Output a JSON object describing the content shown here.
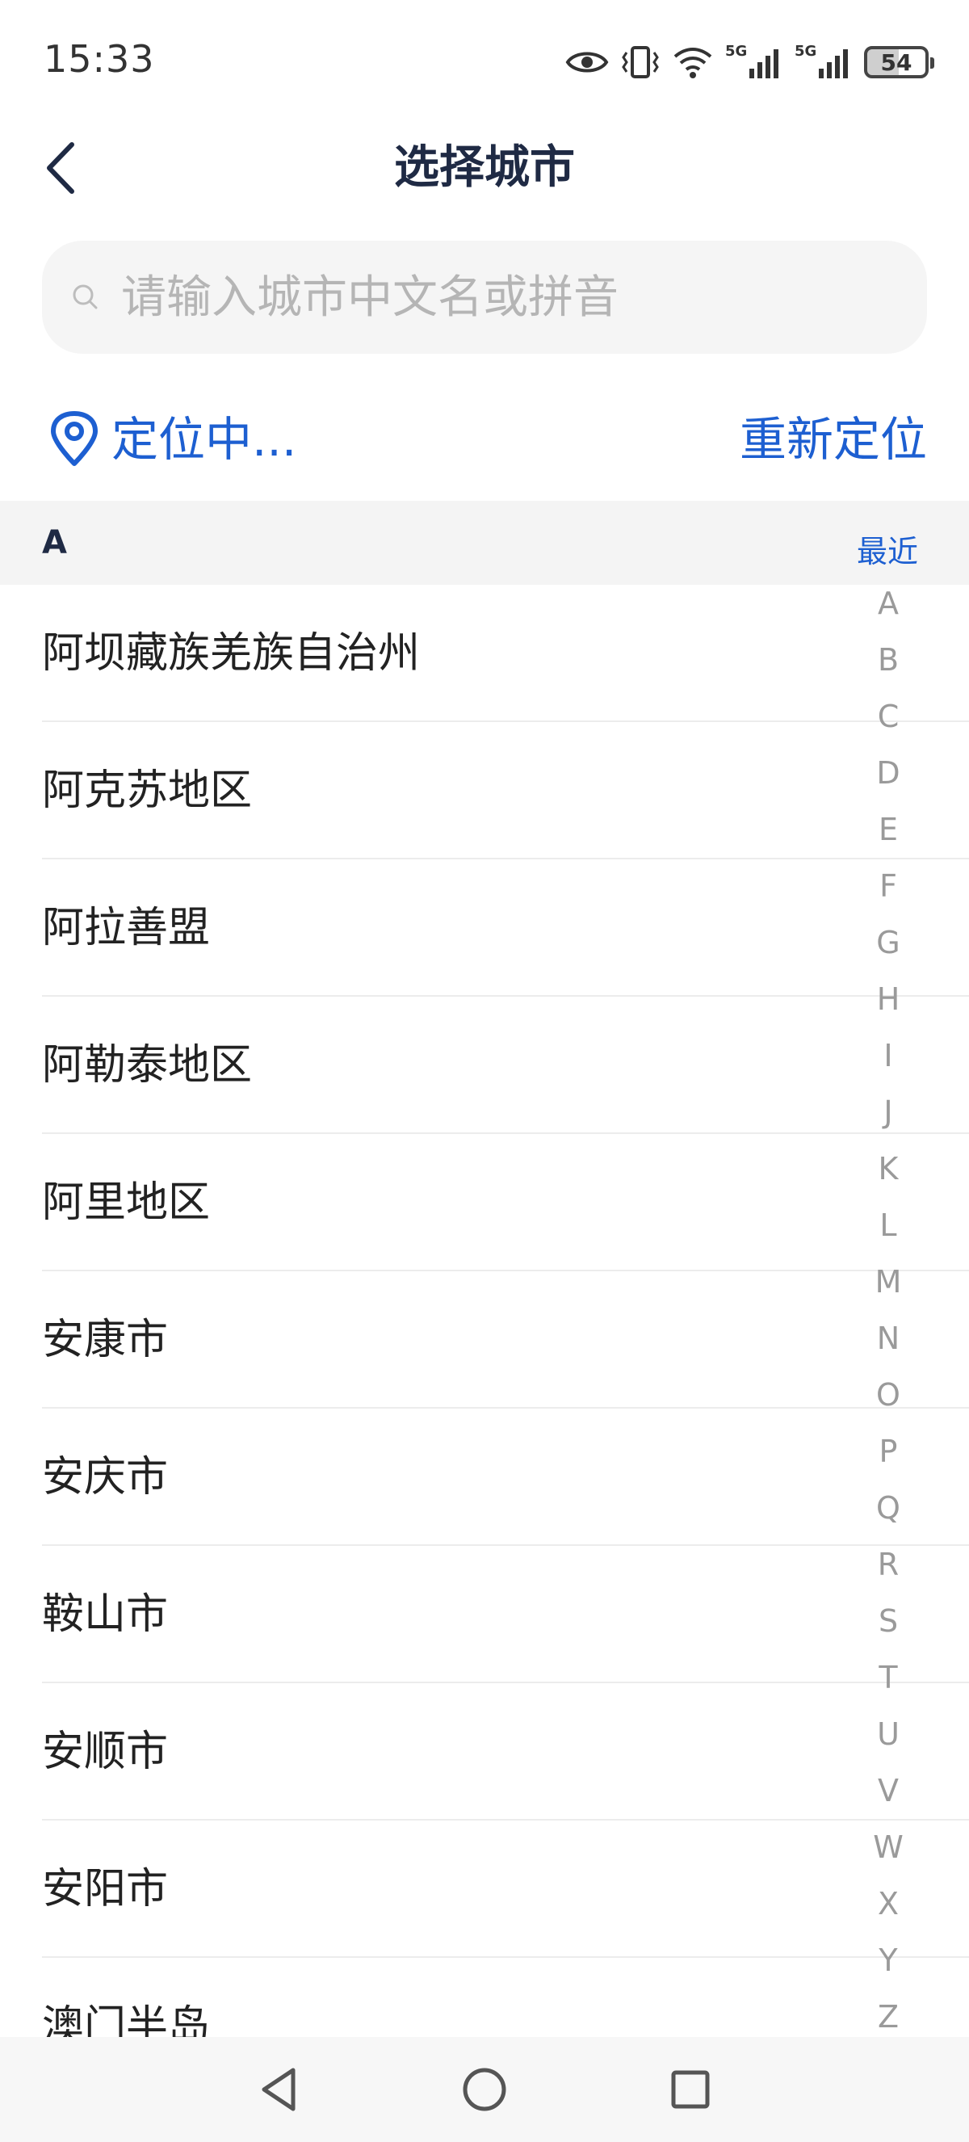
{
  "status_bar": {
    "time": "15:33",
    "battery": "54",
    "icons": [
      "eye-icon",
      "vibrate-icon",
      "wifi-icon",
      "signal-5g-icon",
      "signal-5g-icon"
    ],
    "network_label_1": "5G",
    "network_label_2": "5G"
  },
  "header": {
    "title": "选择城市",
    "back_icon": "chevron-left-icon"
  },
  "search": {
    "placeholder": "请输入城市中文名或拼音",
    "value": ""
  },
  "location": {
    "status": "定位中...",
    "relocate_label": "重新定位",
    "icon": "location-pin-icon"
  },
  "section": {
    "letter": "A",
    "recent_label": "最近"
  },
  "cities": [
    "阿坝藏族羌族自治州",
    "阿克苏地区",
    "阿拉善盟",
    "阿勒泰地区",
    "阿里地区",
    "安康市",
    "安庆市",
    "鞍山市",
    "安顺市",
    "安阳市",
    "澳门半岛"
  ],
  "alphabet": [
    "A",
    "B",
    "C",
    "D",
    "E",
    "F",
    "G",
    "H",
    "I",
    "J",
    "K",
    "L",
    "M",
    "N",
    "O",
    "P",
    "Q",
    "R",
    "S",
    "T",
    "U",
    "V",
    "W",
    "X",
    "Y",
    "Z"
  ],
  "nav_bar": {
    "icons": [
      "back-triangle-icon",
      "home-circle-icon",
      "recents-square-icon"
    ]
  },
  "colors": {
    "accent": "#1d5fd1",
    "title": "#1f2a44",
    "section_bg": "#f4f4f4",
    "index_text": "#9a9a9a"
  }
}
